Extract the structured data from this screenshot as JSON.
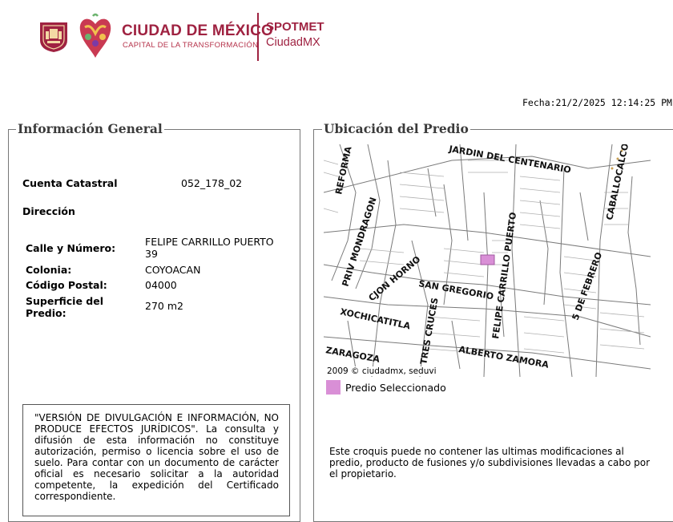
{
  "header": {
    "logo_title": "CIUDAD DE MÉXICO",
    "logo_subtitle": "CAPITAL DE LA TRANSFORMACIÓN",
    "brand_line1": "SPOTMET",
    "brand_line2": "CiudadMX"
  },
  "date": "Fecha:21/2/2025 12:14:25 PM",
  "colors": {
    "brand": "#9f2241",
    "selected": "#d98fd6"
  },
  "general": {
    "legend": "Información General",
    "cuenta_label": "Cuenta Catastral",
    "cuenta_value": "052_178_02",
    "direccion_label": "Dirección",
    "calle_label": "Calle y Número:",
    "calle_value_line1": "FELIPE CARRILLO PUERTO",
    "calle_value_line2": "39",
    "colonia_label": "Colonia:",
    "colonia_value": "COYOACAN",
    "cp_label": "Código Postal:",
    "cp_value": "04000",
    "superficie_label_line1": "Superficie del",
    "superficie_label_line2": "Predio:",
    "superficie_value": "270 m2",
    "disclaimer": "\"VERSIÓN DE DIVULGACIÓN E INFORMACIÓN, NO PRODUCE EFECTOS JURÍDICOS\". La consulta y difusión de esta información no constituye autorización, permiso o licencia sobre el uso de suelo. Para contar con un documento de carácter oficial es necesario solicitar a la autoridad competente, la expedición del Certificado correspondiente."
  },
  "ubicacion": {
    "legend": "Ubicación del Predio",
    "copyright": "2009 © ciudadmx, seduvi",
    "selected_label": "Predio Seleccionado",
    "note": "Este croquis puede no contener las ultimas modificaciones al predio, producto de fusiones y/o subdivisiones llevadas a cabo por el propietario.",
    "streets": {
      "jardin": "JARDIN DEL CENTENARIO",
      "reforma": "REFORMA",
      "mondragon": "PRIV MONDRAGON",
      "horno": "CJON HORNO",
      "gregorio": "SAN GREGORIO",
      "carrillo": "FELIPE CARRILLO PUERTO",
      "caballo": "CABALLOCALCO",
      "febrero": "5 DE FEBRERO",
      "xochicatitla": "XOCHICATITLA",
      "cruces": "TRES CRUCES",
      "zaragoza": "ZARAGOZA",
      "alberto": "ALBERTO ZAMORA"
    }
  }
}
